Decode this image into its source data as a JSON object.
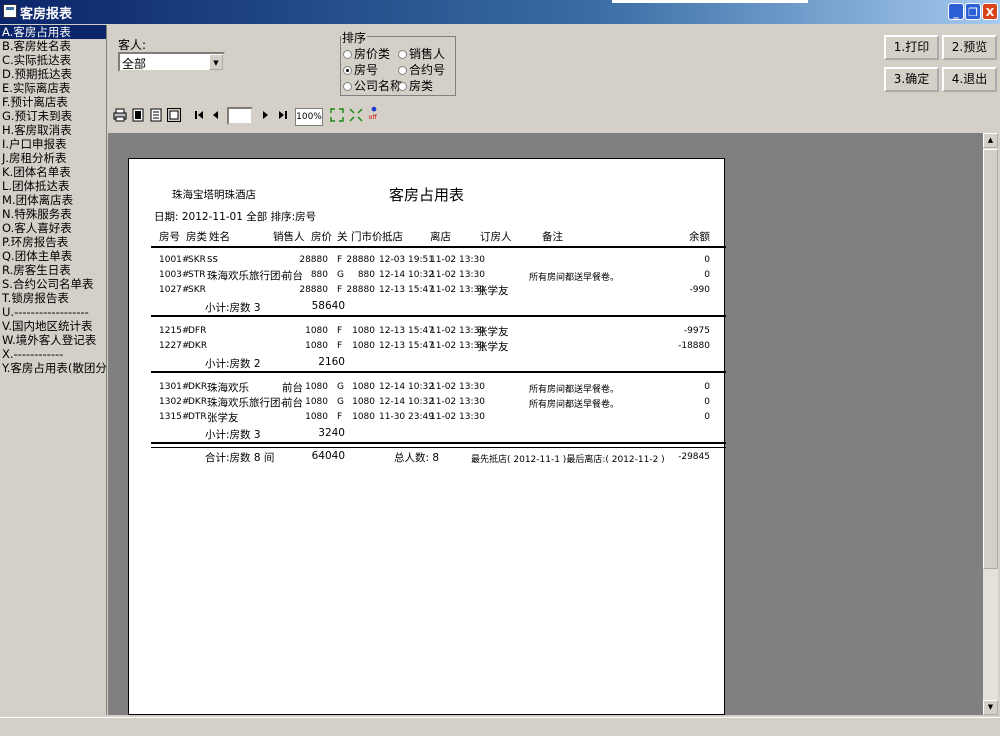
{
  "window": {
    "title": "客房报表"
  },
  "left_list": [
    "A.客房占用表",
    "B.客房姓名表",
    "C.实际抵达表",
    "D.预期抵达表",
    "E.实际离店表",
    "F.预计离店表",
    "G.预订未到表",
    "H.客房取消表",
    "I.户口申报表",
    "J.房租分析表",
    "K.团体名单表",
    "L.团体抵达表",
    "M.团体离店表",
    "N.特殊服务表",
    "O.客人喜好表",
    "P.环房报告表",
    "Q.团体主单表",
    "R.房客生日表",
    "S.合约公司名单表",
    "T.锁房报告表",
    "U.------------------",
    "V.国内地区统计表",
    "W.境外客人登记表",
    "X.------------",
    "Y.客房占用表(散团分开"
  ],
  "guest_filter": {
    "label": "客人:",
    "value": "全部"
  },
  "sort": {
    "legend": "排序",
    "options": [
      "房价类",
      "销售人",
      "房号",
      "合约号",
      "公司名称",
      "房类"
    ],
    "selected": "房号"
  },
  "buttons": {
    "print": "1.打印",
    "preview": "2.预览",
    "confirm": "3.确定",
    "exit": "4.退出"
  },
  "toolbar": {
    "zoom": "100%",
    "page": "",
    "off": "off"
  },
  "report": {
    "hotel": "珠海宝塔明珠酒店",
    "title": "客房占用表",
    "subline": "日期: 2012-11-01   全部  排序:房号",
    "headers": [
      "房号",
      "房类",
      "姓名",
      "销售人",
      "房价",
      "关",
      "门市价",
      "抵店",
      "离店",
      "订房人",
      "备注",
      "余额"
    ],
    "groups": [
      {
        "rows": [
          {
            "room": "1001#",
            "type": "SKR",
            "name": "ss",
            "sales": "",
            "price": "28880",
            "flag": "F",
            "rack": "28880",
            "arr": "12-03 19:51",
            "dep": "11-02 13:30",
            "booker": "",
            "note": "",
            "bal": "0"
          },
          {
            "room": "1003#",
            "type": "STR",
            "name": "珠海欢乐旅行团-",
            "sales": "前台",
            "price": "880",
            "flag": "G",
            "rack": "880",
            "arr": "12-14 10:32",
            "dep": "11-02 13:30",
            "booker": "",
            "note": "所有房间都送早餐卷。",
            "bal": "0"
          },
          {
            "room": "1027#",
            "type": "SKR",
            "name": "",
            "sales": "",
            "price": "28880",
            "flag": "F",
            "rack": "28880",
            "arr": "12-13 15:47",
            "dep": "11-02 13:30",
            "booker": "张学友",
            "note": "",
            "bal": "-990"
          }
        ],
        "subtotal": "小计:房数 3",
        "subsum": "58640"
      },
      {
        "rows": [
          {
            "room": "1215#",
            "type": "DFR",
            "name": "",
            "sales": "",
            "price": "1080",
            "flag": "F",
            "rack": "1080",
            "arr": "12-13 15:47",
            "dep": "11-02 13:30",
            "booker": "张学友",
            "note": "",
            "bal": "-9975"
          },
          {
            "room": "1227#",
            "type": "DKR",
            "name": "",
            "sales": "",
            "price": "1080",
            "flag": "F",
            "rack": "1080",
            "arr": "12-13 15:47",
            "dep": "11-02 13:30",
            "booker": "张学友",
            "note": "",
            "bal": "-18880"
          }
        ],
        "subtotal": "小计:房数 2",
        "subsum": "2160"
      },
      {
        "rows": [
          {
            "room": "1301#",
            "type": "DKR",
            "name": "珠海欢乐",
            "sales": "前台",
            "price": "1080",
            "flag": "G",
            "rack": "1080",
            "arr": "12-14 10:32",
            "dep": "11-02 13:30",
            "booker": "",
            "note": "所有房间都送早餐卷。",
            "bal": "0"
          },
          {
            "room": "1302#",
            "type": "DKR",
            "name": "珠海欢乐旅行团-",
            "sales": "前台",
            "price": "1080",
            "flag": "G",
            "rack": "1080",
            "arr": "12-14 10:32",
            "dep": "11-02 13:30",
            "booker": "",
            "note": "所有房间都送早餐卷。",
            "bal": "0"
          },
          {
            "room": "1315#",
            "type": "DTR",
            "name": "张学友",
            "sales": "",
            "price": "1080",
            "flag": "F",
            "rack": "1080",
            "arr": "11-30 23:49",
            "dep": "11-02 13:30",
            "booker": "",
            "note": "",
            "bal": "0"
          }
        ],
        "subtotal": "小计:房数 3",
        "subsum": "3240"
      }
    ],
    "total": {
      "label": "合计:房数 8 间",
      "sum": "64040",
      "people": "总人数: 8",
      "range": "最先抵店( 2012-11-1 )最后离店:( 2012-11-2 )",
      "bal": "-29845"
    }
  }
}
